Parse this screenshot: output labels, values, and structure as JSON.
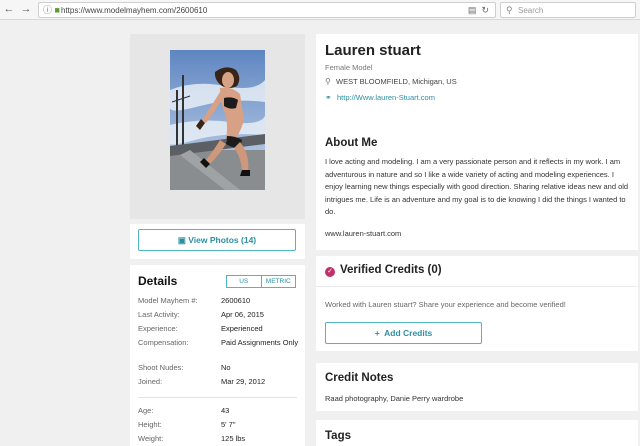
{
  "browser": {
    "url": "https://www.modelmayhem.com/2600610",
    "search_placeholder": "Search"
  },
  "photo_panel": {
    "view_photos_label": "View Photos (14)"
  },
  "details": {
    "title": "Details",
    "units": [
      "US",
      "METRIC"
    ],
    "rows": [
      {
        "label": "Model Mayhem #:",
        "value": "2600610"
      },
      {
        "label": "Last Activity:",
        "value": "Apr 06, 2015"
      },
      {
        "label": "Experience:",
        "value": "Experienced"
      },
      {
        "label": "Compensation:",
        "value": "Paid Assignments Only"
      },
      {
        "label": "Shoot Nudes:",
        "value": "No"
      },
      {
        "label": "Joined:",
        "value": "Mar 29, 2012"
      },
      {
        "label": "Age:",
        "value": "43"
      },
      {
        "label": "Height:",
        "value": "5' 7\""
      },
      {
        "label": "Weight:",
        "value": "125 lbs"
      }
    ]
  },
  "profile": {
    "name": "Lauren stuart",
    "role": "Female Model",
    "location": "WEST BLOOMFIELD, Michigan, US",
    "website": "http://Www.lauren-Stuart.com"
  },
  "about": {
    "title": "About Me",
    "text": "I love acting and modeling. I am a very passionate person and it reflects in my work. I am adventurous in nature and so I like a wide variety of acting and modeling experiences. I enjoy learning new things especially with good direction. Sharing relative ideas new and old intrigues me. Life is an adventure and my goal is to die knowing I did the things I wanted to do.",
    "site": "www.lauren-stuart.com"
  },
  "verified": {
    "title": "Verified Credits (0)",
    "prompt": "Worked with Lauren stuart? Share your experience and become verified!",
    "add_label": "Add Credits"
  },
  "credit_notes": {
    "title": "Credit Notes",
    "text": "Raad photography, Danie Perry wardrobe"
  },
  "tags": {
    "title": "Tags"
  },
  "colors": {
    "accent": "#4fb4c4",
    "verified": "#c0306a"
  }
}
